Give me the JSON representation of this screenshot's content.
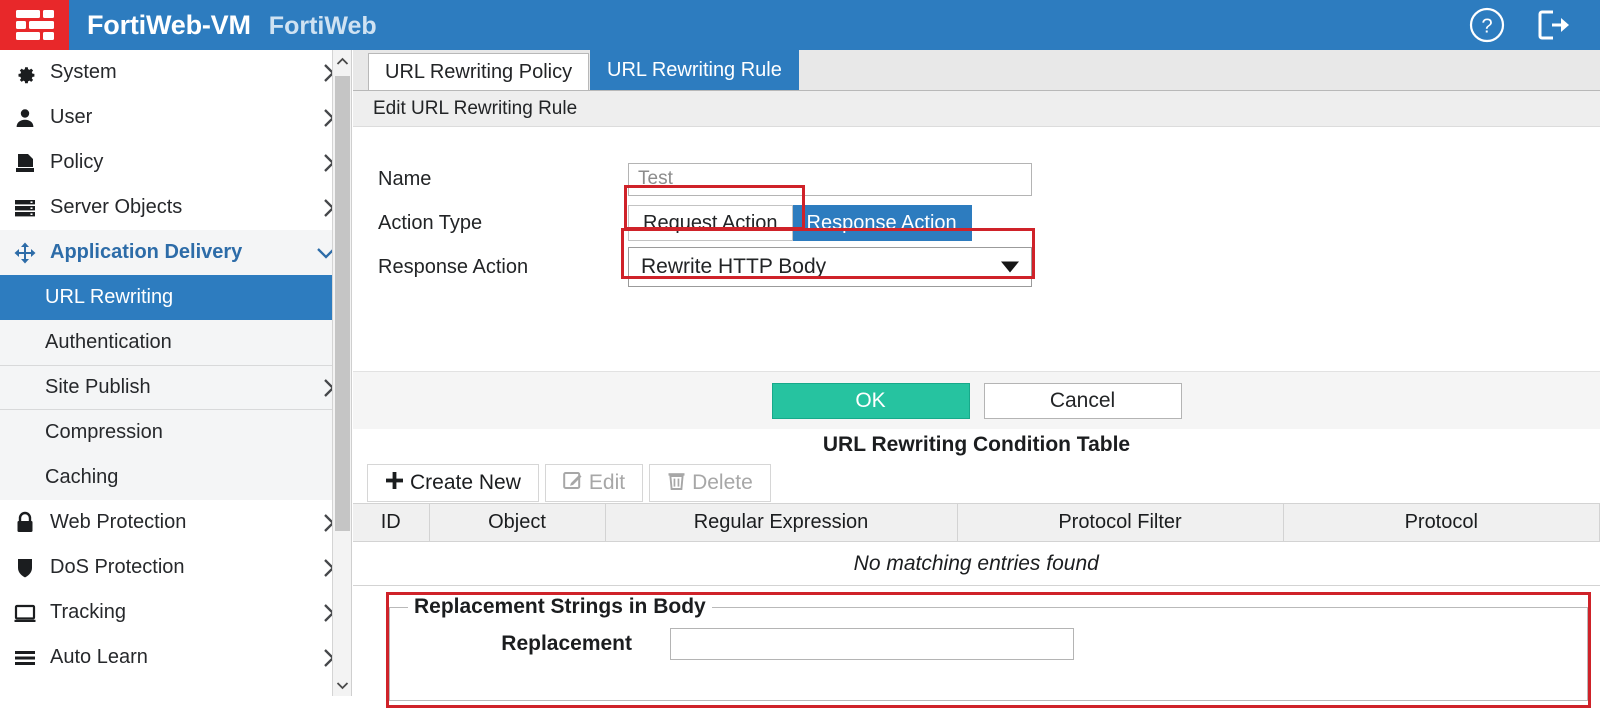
{
  "header": {
    "product": "FortiWeb-VM",
    "product_sub": "FortiWeb",
    "logo_icon": "fortinet-grid-logo-icon",
    "help_icon": "help-circle-icon",
    "logout_icon": "logout-icon"
  },
  "sidebar": {
    "items": [
      {
        "label": "System",
        "icon": "gear-icon",
        "arrow": "chevron-right-icon",
        "type": "group"
      },
      {
        "label": "User",
        "icon": "user-icon",
        "arrow": "chevron-right-icon",
        "type": "group"
      },
      {
        "label": "Policy",
        "icon": "policy-document-icon",
        "arrow": "chevron-right-icon",
        "type": "group"
      },
      {
        "label": "Server Objects",
        "icon": "server-stack-icon",
        "arrow": "chevron-right-icon",
        "type": "group"
      },
      {
        "label": "Application Delivery",
        "icon": "move-arrows-icon",
        "arrow": "chevron-down-icon",
        "type": "group-open"
      },
      {
        "label": "URL Rewriting",
        "type": "sub",
        "state": "active"
      },
      {
        "label": "Authentication",
        "type": "sub"
      },
      {
        "label": "Site Publish",
        "type": "sub",
        "arrow": "chevron-right-icon"
      },
      {
        "label": "Compression",
        "type": "sub"
      },
      {
        "label": "Caching",
        "type": "sub"
      },
      {
        "label": "Web Protection",
        "icon": "lock-icon",
        "arrow": "chevron-right-icon",
        "type": "group"
      },
      {
        "label": "DoS Protection",
        "icon": "shield-icon",
        "arrow": "chevron-right-icon",
        "type": "group"
      },
      {
        "label": "Tracking",
        "icon": "monitor-icon",
        "arrow": "chevron-right-icon",
        "type": "group"
      },
      {
        "label": "Auto Learn",
        "icon": "lines-icon",
        "arrow": "chevron-right-icon",
        "type": "group"
      }
    ],
    "scrollbar": {
      "up_icon": "scroll-up-arrow-icon",
      "down_icon": "scroll-down-arrow-icon"
    }
  },
  "tabs": [
    {
      "label": "URL Rewriting Policy",
      "active": false
    },
    {
      "label": "URL Rewriting Rule",
      "active": true
    }
  ],
  "page": {
    "subtitle": "Edit URL Rewriting Rule"
  },
  "form": {
    "name_label": "Name",
    "name_value": "",
    "name_placeholder": "Test",
    "action_type_label": "Action Type",
    "action_type_options": [
      {
        "label": "Request Action",
        "selected": false
      },
      {
        "label": "Response Action",
        "selected": true
      }
    ],
    "response_action_label": "Response Action",
    "response_action_value": "Rewrite HTTP Body",
    "dropdown_icon": "caret-down-icon"
  },
  "buttons": {
    "ok": "OK",
    "cancel": "Cancel"
  },
  "condition_table": {
    "title": "URL Rewriting Condition Table",
    "toolbar": [
      {
        "label": "Create New",
        "icon": "plus-icon",
        "disabled": false
      },
      {
        "label": "Edit",
        "icon": "edit-pencil-icon",
        "disabled": true
      },
      {
        "label": "Delete",
        "icon": "trash-icon",
        "disabled": true
      }
    ],
    "columns": [
      "ID",
      "Object",
      "Regular Expression",
      "Protocol Filter",
      "Protocol"
    ],
    "rows": [],
    "empty_message": "No matching entries found"
  },
  "replacement": {
    "legend": "Replacement Strings in Body",
    "field_label": "Replacement",
    "field_value": "",
    "field_placeholder": ""
  },
  "colors": {
    "header_blue": "#2d7cbf",
    "logo_red": "#e8282a",
    "ok_green": "#26c3a0",
    "annotation_red": "#cf2229",
    "active_nav_blue": "#2d7cbf"
  }
}
